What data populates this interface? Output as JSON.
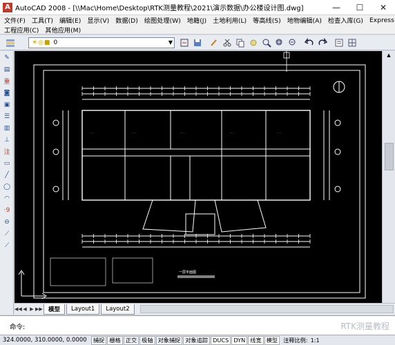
{
  "window": {
    "title": "AutoCAD 2008 - [\\\\Mac\\Home\\Desktop\\RTK测量教程\\2021\\演示数据\\办公楼设计图.dwg]",
    "logo": "A",
    "minimize": "—",
    "maximize": "☐",
    "close": "✕"
  },
  "menu": {
    "row1": [
      "文件(F)",
      "工具(T)",
      "编辑(E)",
      "显示(V)",
      "数据(D)",
      "绘图处理(W)",
      "地籍(J)",
      "土地利用(L)",
      "等高线(S)",
      "地物编辑(A)",
      "检查入库(G)",
      "Express"
    ],
    "row2": [
      "工程应用(C)",
      "其他应用(M)"
    ]
  },
  "toolbar": {
    "layer_value": "0",
    "layer_state_icons": "☀◎■",
    "icons": [
      "layer-manager-icon",
      "save-icon",
      "brush-icon",
      "cut-icon",
      "copy-icon",
      "pan-icon",
      "zoom-realtime-icon",
      "zoom-window-icon",
      "zoom-previous-icon",
      "undo-icon",
      "redo-icon",
      "properties-icon",
      "grid-icon"
    ]
  },
  "left_tools": {
    "items": [
      {
        "name": "draw-tool-icon",
        "glyph": "✎"
      },
      {
        "name": "layers-tool-icon",
        "glyph": "▤"
      },
      {
        "name": "red-tool-icon",
        "glyph": "重"
      },
      {
        "name": "camera-tool-icon",
        "glyph": "◙"
      },
      {
        "name": "square-tool-icon",
        "glyph": "▣"
      },
      {
        "name": "list-tool-icon",
        "glyph": "☰"
      },
      {
        "name": "chart-tool-icon",
        "glyph": "▥"
      },
      {
        "name": "measure-tool-icon",
        "glyph": "⊥"
      },
      {
        "name": "annotation-tool-icon",
        "glyph": "注"
      },
      {
        "name": "rectangle-tool-icon",
        "glyph": "▭"
      },
      {
        "name": "line-tool-icon",
        "glyph": "╱"
      },
      {
        "name": "circle-tool-icon",
        "glyph": "◯"
      },
      {
        "name": "arc-tool-icon",
        "glyph": "◠"
      },
      {
        "name": "point-tool-icon",
        "glyph": "·9"
      },
      {
        "name": "offset-tool-icon",
        "glyph": "⊖"
      },
      {
        "name": "slope-tool-icon",
        "glyph": "⟋"
      },
      {
        "name": "hatch-tool-icon",
        "glyph": "⟋"
      }
    ]
  },
  "tabs": [
    "模型",
    "Layout1",
    "Layout2"
  ],
  "command": {
    "prompt": "命令:"
  },
  "watermark": "RTK测量教程",
  "status": {
    "coords": "324.0000, 310.0000, 0.0000",
    "buttons": [
      "捕捉",
      "栅格",
      "正交",
      "极轴",
      "对象捕捉",
      "对象追踪",
      "DUCS",
      "DYN",
      "线宽",
      "模型"
    ],
    "annotation_scale_label": "注释比例:",
    "annotation_scale_value": "1:1"
  },
  "drawing": {
    "stair_label": "一层平面图",
    "accent": "#ffffff"
  }
}
